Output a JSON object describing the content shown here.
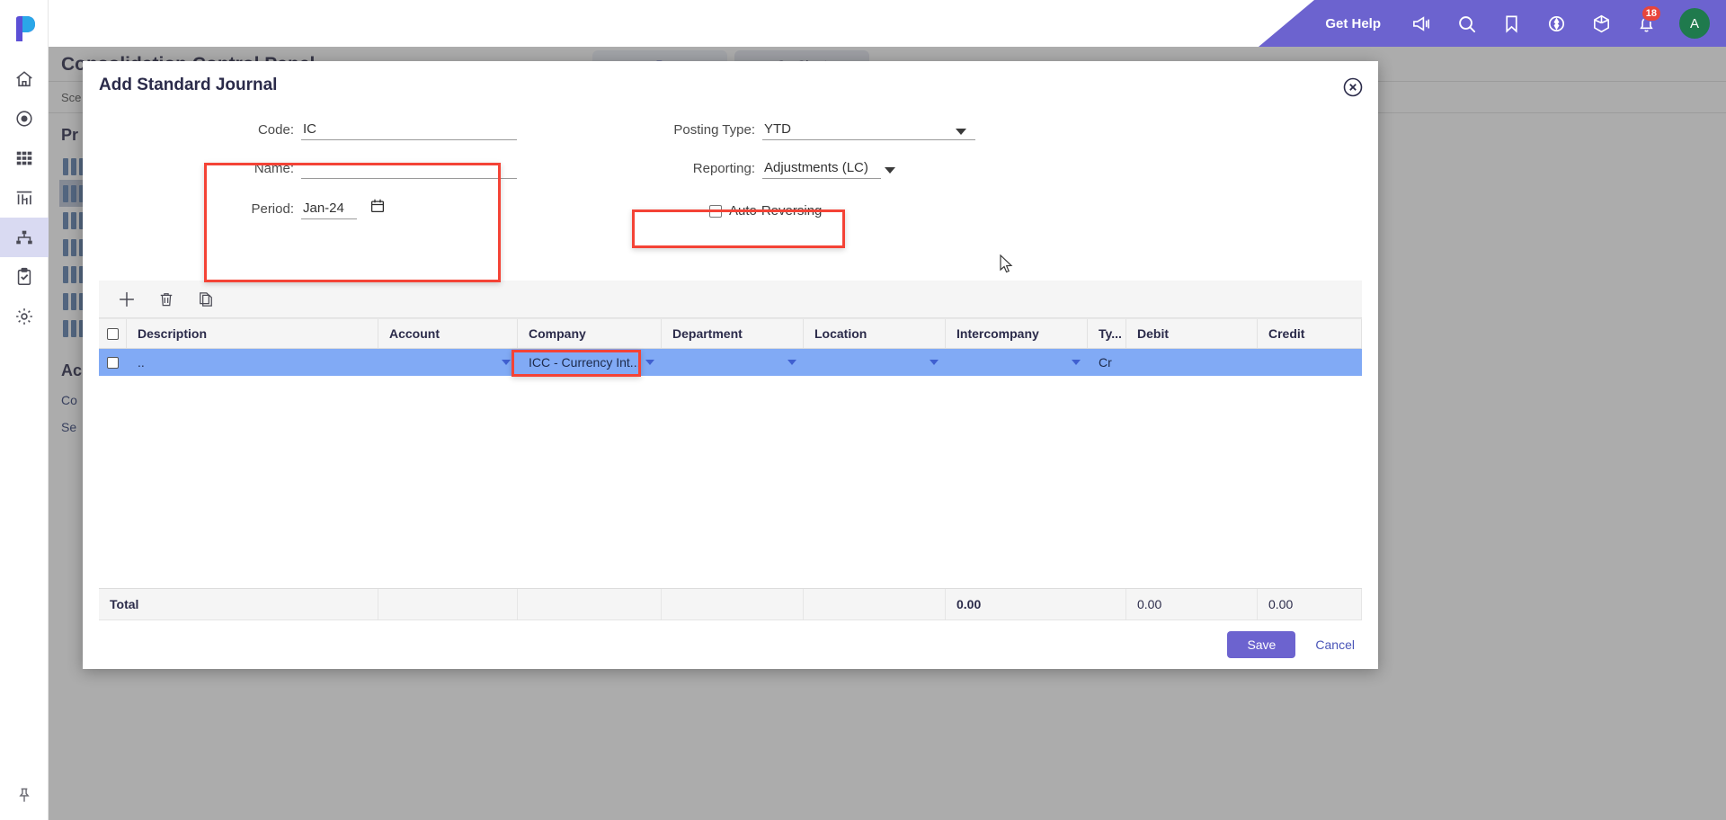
{
  "topbar": {
    "get_help": "Get Help",
    "icons": [
      "megaphone-icon",
      "search-icon",
      "bookmark-icon",
      "target-icon",
      "cube-icon",
      "bell-icon"
    ],
    "notification_count": "18",
    "avatar_initial": "A",
    "accent_color": "#6c63cf",
    "badge_color": "#e8453c",
    "avatar_color": "#1f7a4d"
  },
  "sidebar": {
    "logo": "planful-logo",
    "items": [
      {
        "icon": "home-icon",
        "label": "Home",
        "active": false
      },
      {
        "icon": "target-icon",
        "label": "Record",
        "active": false
      },
      {
        "icon": "grid-icon",
        "label": "Apps",
        "active": false
      },
      {
        "icon": "chart-icon",
        "label": "Reports",
        "active": false
      },
      {
        "icon": "hierarchy-icon",
        "label": "Consolidation",
        "active": true
      },
      {
        "icon": "clipboard-check-icon",
        "label": "Tasks",
        "active": false
      },
      {
        "icon": "gear-icon",
        "label": "Settings",
        "active": false
      }
    ],
    "bottom_icon": "pin-icon"
  },
  "background": {
    "page_title": "Consolidation Control Panel",
    "subbar_text": "Sce",
    "section_title": "Pr",
    "section_title_2": "Ac",
    "links": [
      "Co",
      "Se"
    ],
    "bar_rows": 7,
    "selected_bar_row": 1,
    "tab_labels": [
      "P",
      "On Chart"
    ]
  },
  "modal": {
    "title": "Add Standard Journal",
    "close_icon": "close-circle-icon",
    "form": {
      "code": {
        "label": "Code:",
        "value": "IC"
      },
      "name": {
        "label": "Name:",
        "value": ""
      },
      "period": {
        "label": "Period:",
        "value": "Jan-24",
        "icon": "calendar-icon"
      },
      "posting_type": {
        "label": "Posting Type:",
        "value": "YTD",
        "icon": "chevron-down-icon"
      },
      "reporting": {
        "label": "Reporting:",
        "value": "Adjustments (LC)",
        "icon": "chevron-down-icon"
      },
      "auto_reversing": {
        "label": "Auto-Reversing",
        "checked": false
      }
    },
    "toolbar": {
      "add_icon": "plus-icon",
      "delete_icon": "trash-icon",
      "copy_icon": "copy-icon"
    },
    "grid": {
      "columns": [
        "Description",
        "Account",
        "Company",
        "Department",
        "Location",
        "Intercompany",
        "Ty...",
        "Debit",
        "Credit"
      ],
      "rows": [
        {
          "selected": true,
          "checked": false,
          "description": "..",
          "account": "",
          "company": "ICC - Currency Int...",
          "department": "",
          "location": "",
          "intercompany": "",
          "type": "Cr",
          "debit": "",
          "credit": ""
        }
      ],
      "total_label": "Total",
      "totals": {
        "intercompany": "0.00",
        "debit": "0.00",
        "credit": "0.00"
      }
    },
    "footer": {
      "save_label": "Save",
      "cancel_label": "Cancel"
    },
    "highlights": [
      {
        "name": "code-name-period-highlight",
        "color": "#f44336"
      },
      {
        "name": "reporting-highlight",
        "color": "#f44336"
      },
      {
        "name": "company-cell-highlight",
        "color": "#f44336"
      }
    ]
  }
}
